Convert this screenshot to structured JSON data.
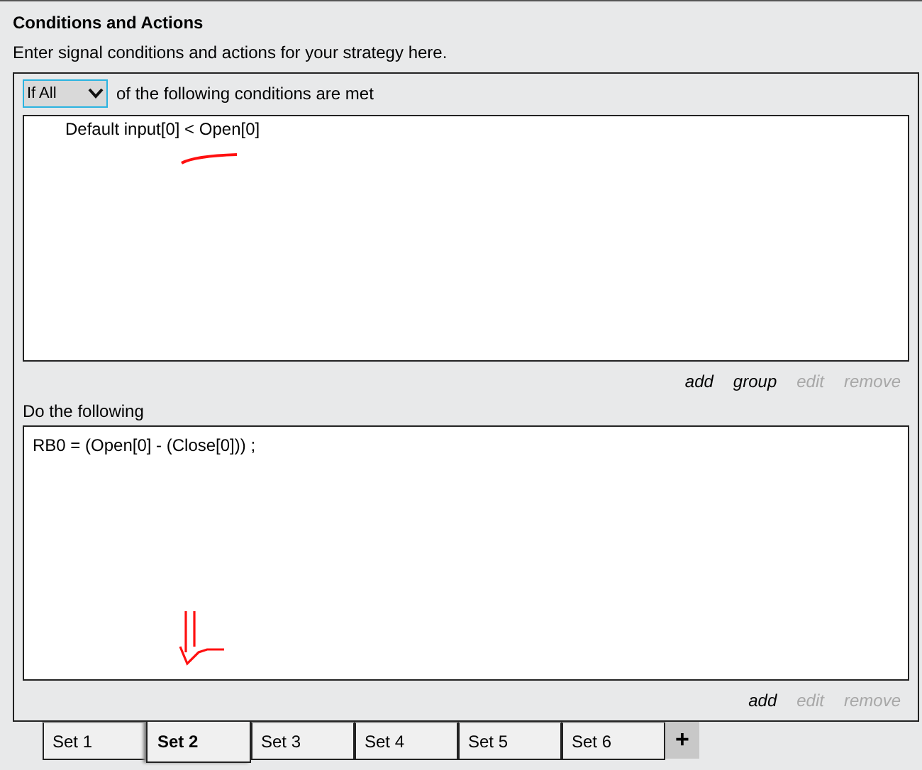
{
  "title": "Conditions and Actions",
  "description": "Enter signal conditions and actions for your strategy here.",
  "match_select": {
    "value": "If All"
  },
  "match_text": "of the following conditions are met",
  "conditions": [
    "Default input[0] < Open[0]"
  ],
  "condition_links": [
    {
      "label": "add",
      "disabled": false
    },
    {
      "label": "group",
      "disabled": false
    },
    {
      "label": "edit",
      "disabled": true
    },
    {
      "label": "remove",
      "disabled": true
    }
  ],
  "actions_label": "Do the following",
  "actions": [
    "RB0 = (Open[0] - (Close[0])) ;"
  ],
  "action_links": [
    {
      "label": "add",
      "disabled": false
    },
    {
      "label": "edit",
      "disabled": true
    },
    {
      "label": "remove",
      "disabled": true
    }
  ],
  "tabs": [
    {
      "label": "Set 1",
      "selected": false
    },
    {
      "label": "Set 2",
      "selected": true
    },
    {
      "label": "Set 3",
      "selected": false
    },
    {
      "label": "Set 4",
      "selected": false
    },
    {
      "label": "Set 5",
      "selected": false
    },
    {
      "label": "Set 6",
      "selected": false
    }
  ],
  "add_tab": "+"
}
